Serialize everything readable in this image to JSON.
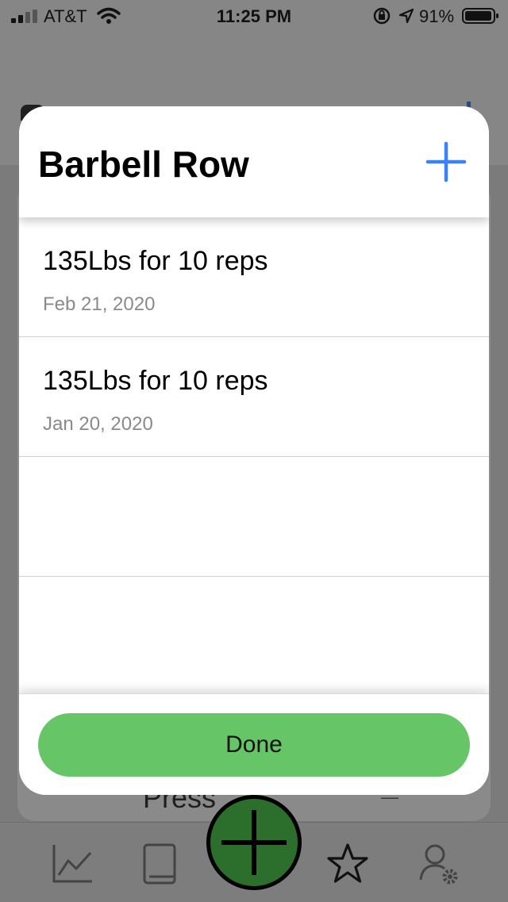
{
  "status_bar": {
    "carrier": "AT&T",
    "time": "11:25 PM",
    "battery": "91%"
  },
  "modal": {
    "title": "Barbell Row",
    "add_icon": "plus-icon",
    "entries": [
      {
        "summary": "135Lbs for 10 reps",
        "date": "Feb 21, 2020"
      },
      {
        "summary": "135Lbs for 10 reps",
        "date": "Jan 20, 2020"
      }
    ],
    "done_label": "Done"
  },
  "background": {
    "card_text": "Press"
  },
  "tab_bar": {
    "icons": [
      "chart-icon",
      "book-icon",
      "add-icon",
      "star-icon",
      "user-settings-icon"
    ]
  },
  "colors": {
    "accent": "#3b82f6",
    "done_button": "#66c566",
    "center_button": "#2c6e2c"
  }
}
